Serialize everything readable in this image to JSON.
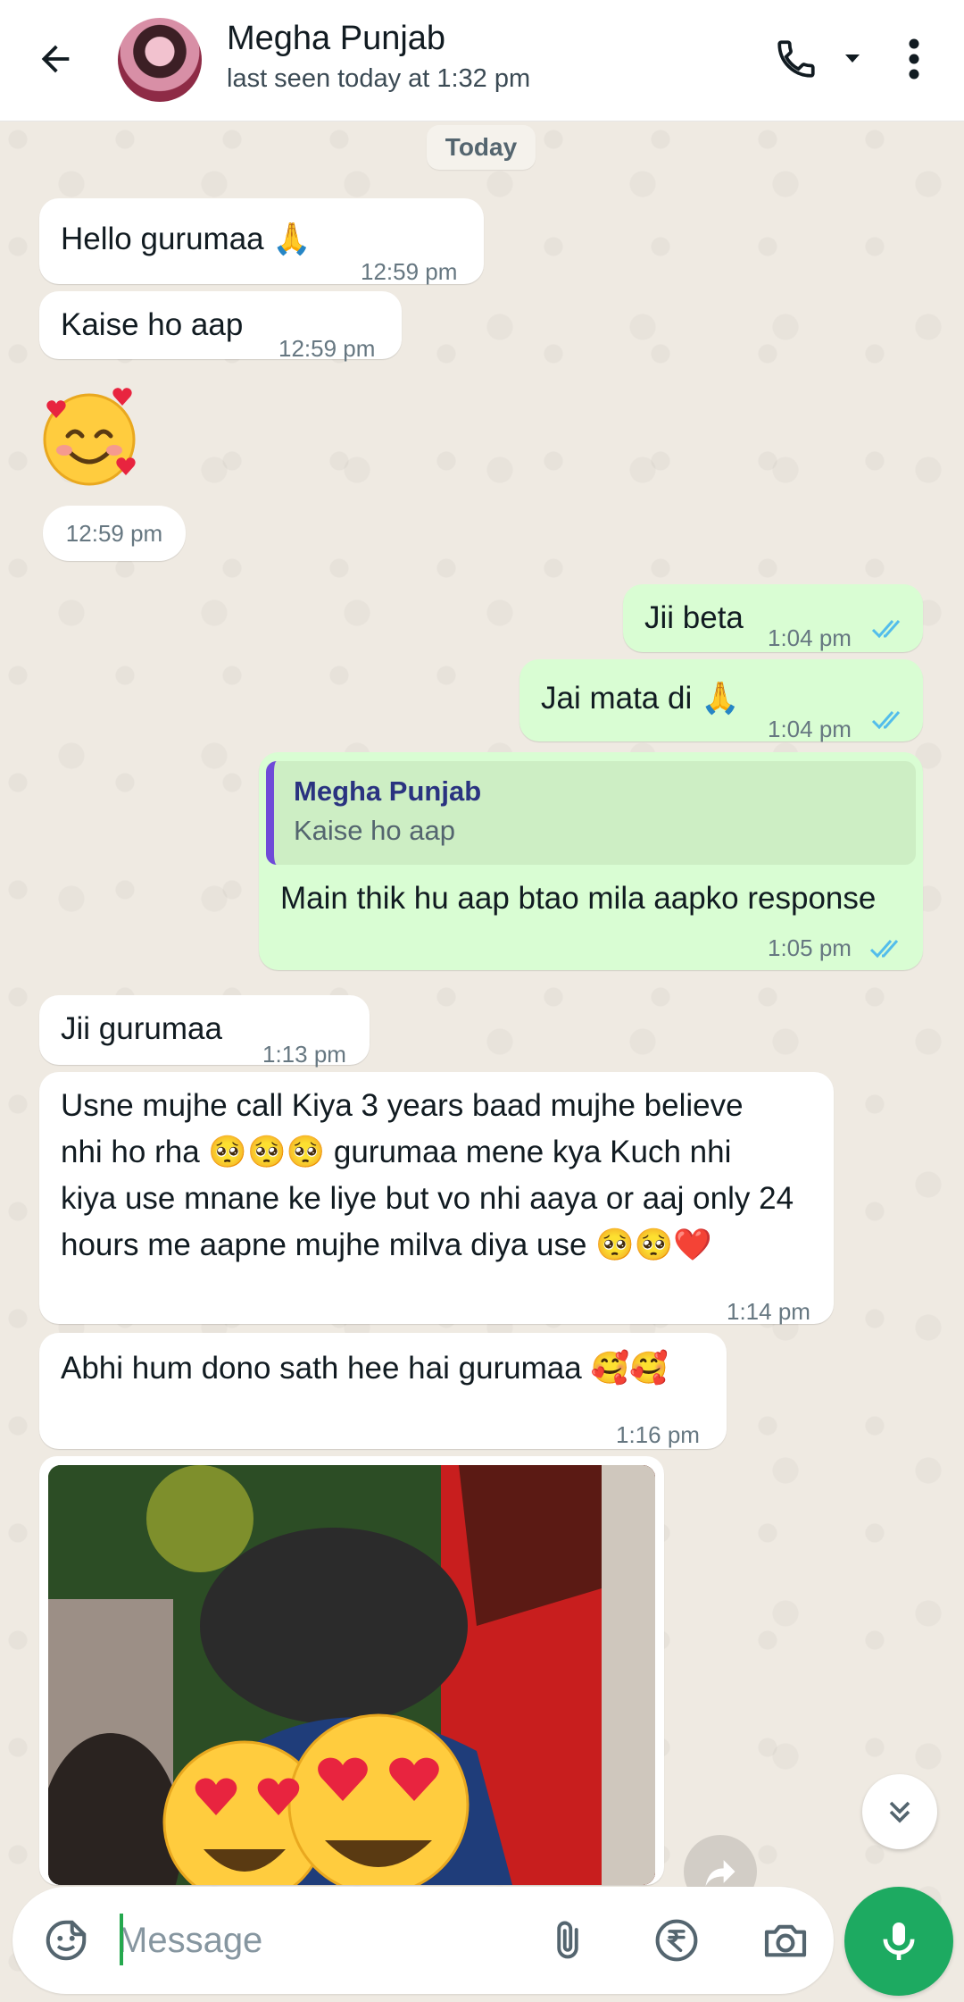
{
  "header": {
    "contact_name": "Megha Punjab",
    "status": "last seen today at 1:32 pm"
  },
  "date_divider": "Today",
  "messages": [
    {
      "dir": "in",
      "text": "Hello gurumaa 🙏",
      "time": "12:59 pm"
    },
    {
      "dir": "in",
      "text": "Kaise ho aap",
      "time": "12:59 pm"
    },
    {
      "dir": "in",
      "text": "🥰",
      "time": "12:59 pm"
    },
    {
      "dir": "out",
      "text": "Jii beta",
      "time": "1:04 pm",
      "status": "read"
    },
    {
      "dir": "out",
      "text": "Jai mata di 🙏",
      "time": "1:04 pm",
      "status": "read"
    },
    {
      "dir": "out",
      "reply_to_name": "Megha Punjab",
      "reply_to_text": "Kaise ho aap",
      "text": "Main thik hu aap btao mila aapko response",
      "time": "1:05 pm",
      "status": "read"
    },
    {
      "dir": "in",
      "text": "Jii gurumaa",
      "time": "1:13 pm"
    },
    {
      "dir": "in",
      "lines": [
        "Usne mujhe call Kiya 3 years baad mujhe believe",
        "nhi ho rha 🥺🥺🥺 gurumaa mene kya Kuch nhi",
        "kiya use mnane ke liye but vo nhi aaya or aaj only 24",
        "hours me aapne mujhe milva diya use 🥺🥺❤️"
      ],
      "time": "1:14 pm"
    },
    {
      "dir": "in",
      "text": "Abhi hum dono sath hee hai gurumaa 🥰🥰",
      "time": "1:16 pm"
    },
    {
      "dir": "in",
      "type": "image",
      "emoji_overlay": "😍😍"
    }
  ],
  "composer": {
    "placeholder": "Message"
  },
  "colors": {
    "outgoing_bubble": "#d9fdd3",
    "incoming_bubble": "#ffffff",
    "read_ticks": "#53bdeb",
    "accent_green": "#1daa61",
    "quote_bar": "#6f4bd8"
  },
  "icons": [
    "back-arrow-icon",
    "phone-icon",
    "chevron-down-icon",
    "more-vertical-icon",
    "sticker-icon",
    "paperclip-icon",
    "rupee-icon",
    "camera-icon",
    "mic-icon",
    "double-chevron-down-icon",
    "forward-icon"
  ]
}
